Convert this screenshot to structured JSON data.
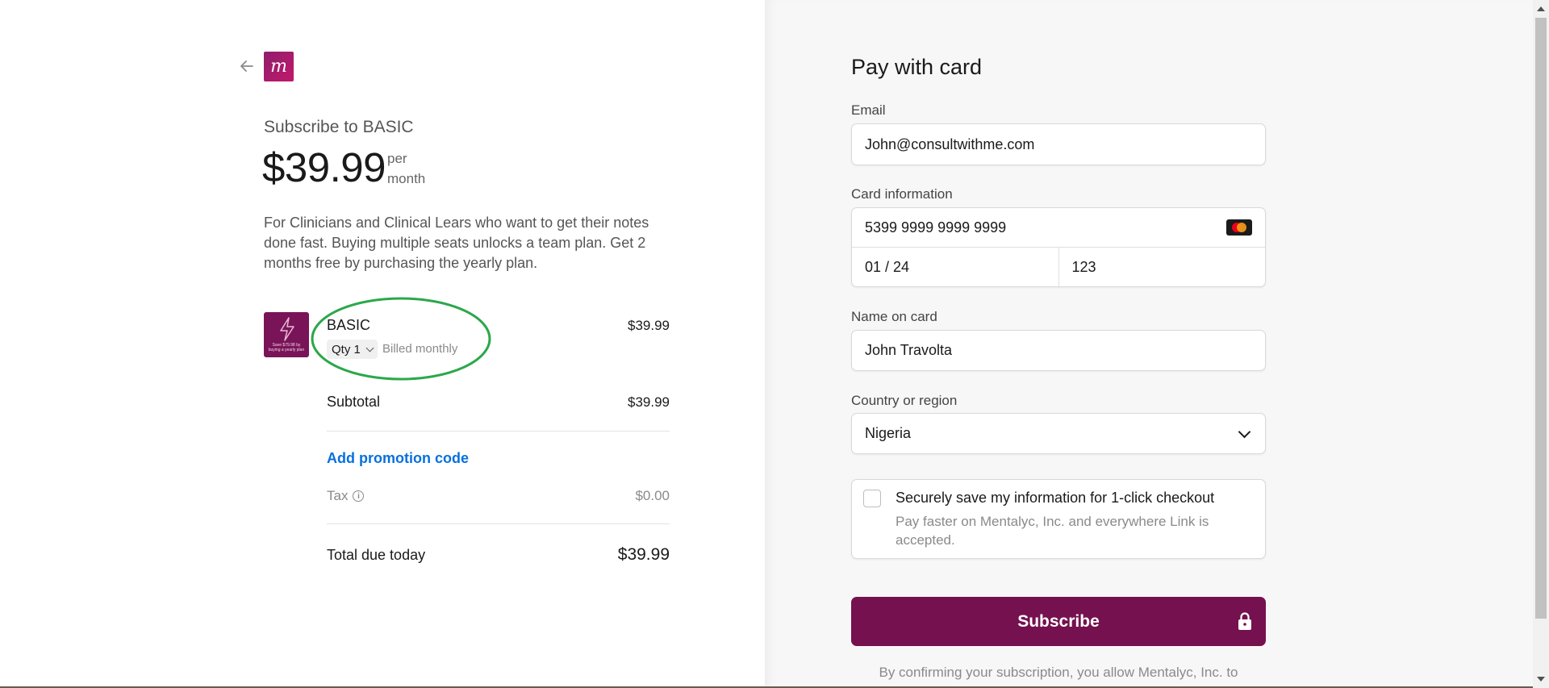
{
  "header": {
    "logo_letter": "m"
  },
  "summary": {
    "subscribe_title": "Subscribe to BASIC",
    "price": "$39.99",
    "per_label": "per month",
    "description": "For Clinicians and Clinical Lears who want to get their notes done fast. Buying multiple seats unlocks a team plan. Get 2 months free by purchasing the yearly plan.",
    "product": {
      "name": "BASIC",
      "qty_label": "Qty 1",
      "billing": "Billed monthly",
      "price": "$39.99",
      "thumb_text": "Save $79.98 by buying a yearly plan"
    },
    "subtotal_label": "Subtotal",
    "subtotal_value": "$39.99",
    "promo_label": "Add promotion code",
    "tax_label": "Tax",
    "tax_value": "$0.00",
    "total_label": "Total due today",
    "total_value": "$39.99"
  },
  "payment": {
    "title": "Pay with card",
    "email_label": "Email",
    "email_value": "John@consultwithme.com",
    "card_label": "Card information",
    "card_number": "5399 9999 9999 9999",
    "card_expiry": "01 / 24",
    "card_cvc": "123",
    "name_label": "Name on card",
    "name_value": "John Travolta",
    "country_label": "Country or region",
    "country_value": "Nigeria",
    "save_title": "Securely save my information for 1-click checkout",
    "save_subtitle": "Pay faster on Mentalyc, Inc. and everywhere Link is accepted.",
    "subscribe_label": "Subscribe",
    "consent_text": "By confirming your subscription, you allow Mentalyc, Inc. to"
  },
  "colors": {
    "brand": "#75114f",
    "link": "#0570de",
    "highlight_ellipse": "#2ba84a"
  }
}
